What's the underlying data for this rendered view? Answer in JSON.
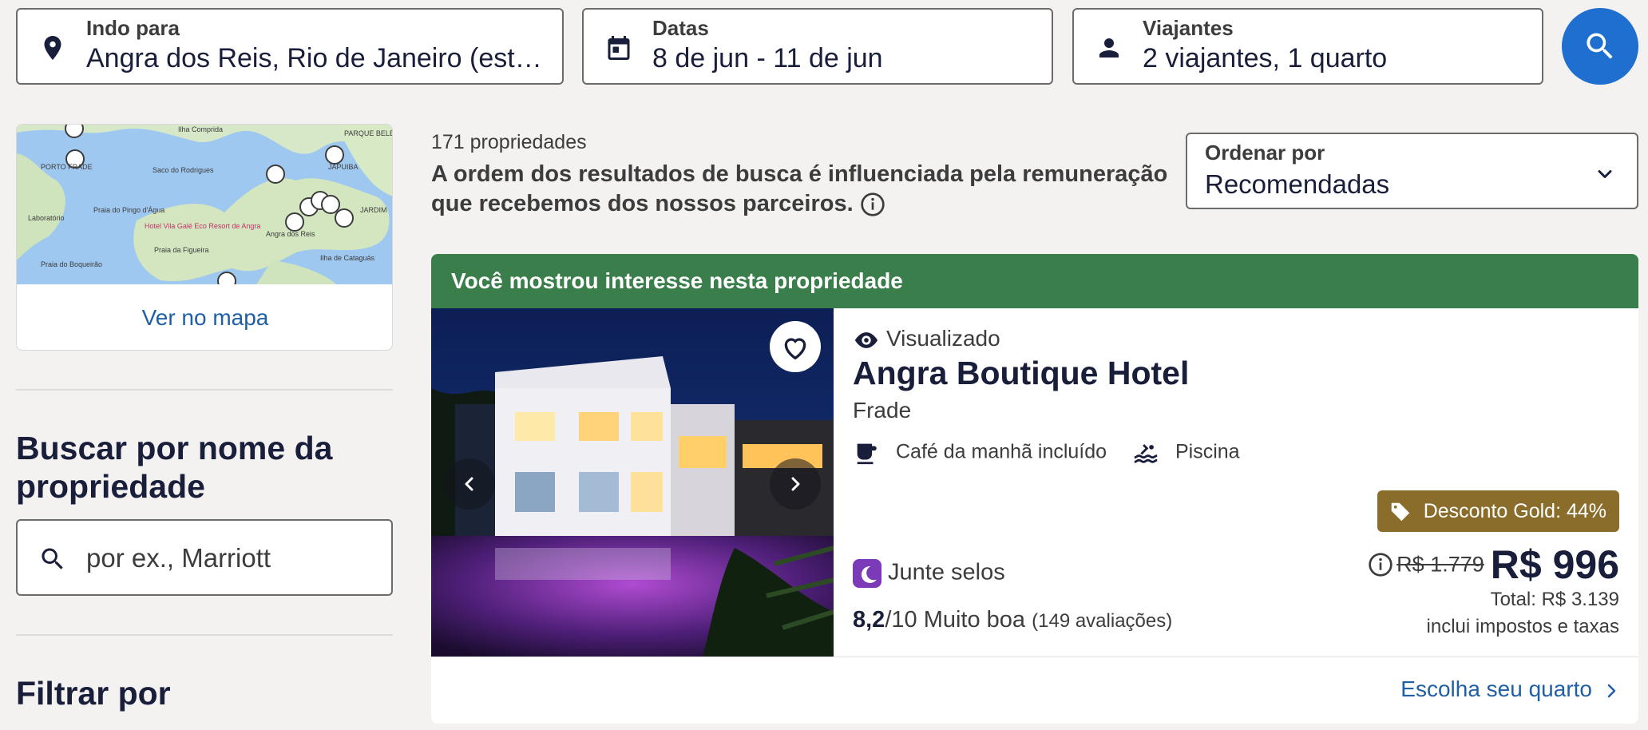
{
  "search": {
    "destination": {
      "label": "Indo para",
      "value": "Angra dos Reis, Rio de Janeiro (estad..."
    },
    "dates": {
      "label": "Datas",
      "value": "8 de jun - 11 de jun"
    },
    "travelers": {
      "label": "Viajantes",
      "value": "2 viajantes, 1 quarto"
    }
  },
  "sidebar": {
    "map_link": "Ver no mapa",
    "map_labels": [
      "Ilha Comprida",
      "PORTO FRADE",
      "Saco do Rodrigues",
      "Praia do Pingo d'Água",
      "Laboratório",
      "Hotel Vila Galé Eco Resort de Angra",
      "Praia da Figueira",
      "Angra dos Reis",
      "JAPUIBA",
      "PARQUE BELÉM",
      "Ilha de Cataguás",
      "JARDIM",
      "Praia do Boqueirão"
    ],
    "name_search_title": "Buscar por nome da propriedade",
    "name_search_placeholder": "por ex., Marriott",
    "filter_title": "Filtrar por"
  },
  "results": {
    "count": "171 propriedades",
    "disclaimer": "A ordem dos resultados de busca é influenciada pela remuneração que recebemos dos nossos parceiros.",
    "sort": {
      "label": "Ordenar por",
      "value": "Recomendadas"
    }
  },
  "property": {
    "banner": "Você mostrou interesse nesta propriedade",
    "viewed": "Visualizado",
    "name": "Angra Boutique Hotel",
    "location": "Frade",
    "amenities": [
      "Café da manhã incluído",
      "Piscina"
    ],
    "stamps": "Junte selos",
    "rating_score": "8,2",
    "rating_scale": "/10 Muito boa",
    "reviews": "(149 avaliações)",
    "discount_badge": "Desconto Gold: 44%",
    "old_price": "R$ 1.779",
    "price": "R$ 996",
    "total": "Total: R$ 3.139",
    "taxes": "inclui impostos e taxas",
    "choose_room": "Escolha seu quarto"
  },
  "colors": {
    "primary": "#1f6fd0",
    "banner": "#3a7f4b",
    "badge": "#8b6d2b",
    "link": "#1f5fa6",
    "stamp": "#7b3ab8"
  }
}
